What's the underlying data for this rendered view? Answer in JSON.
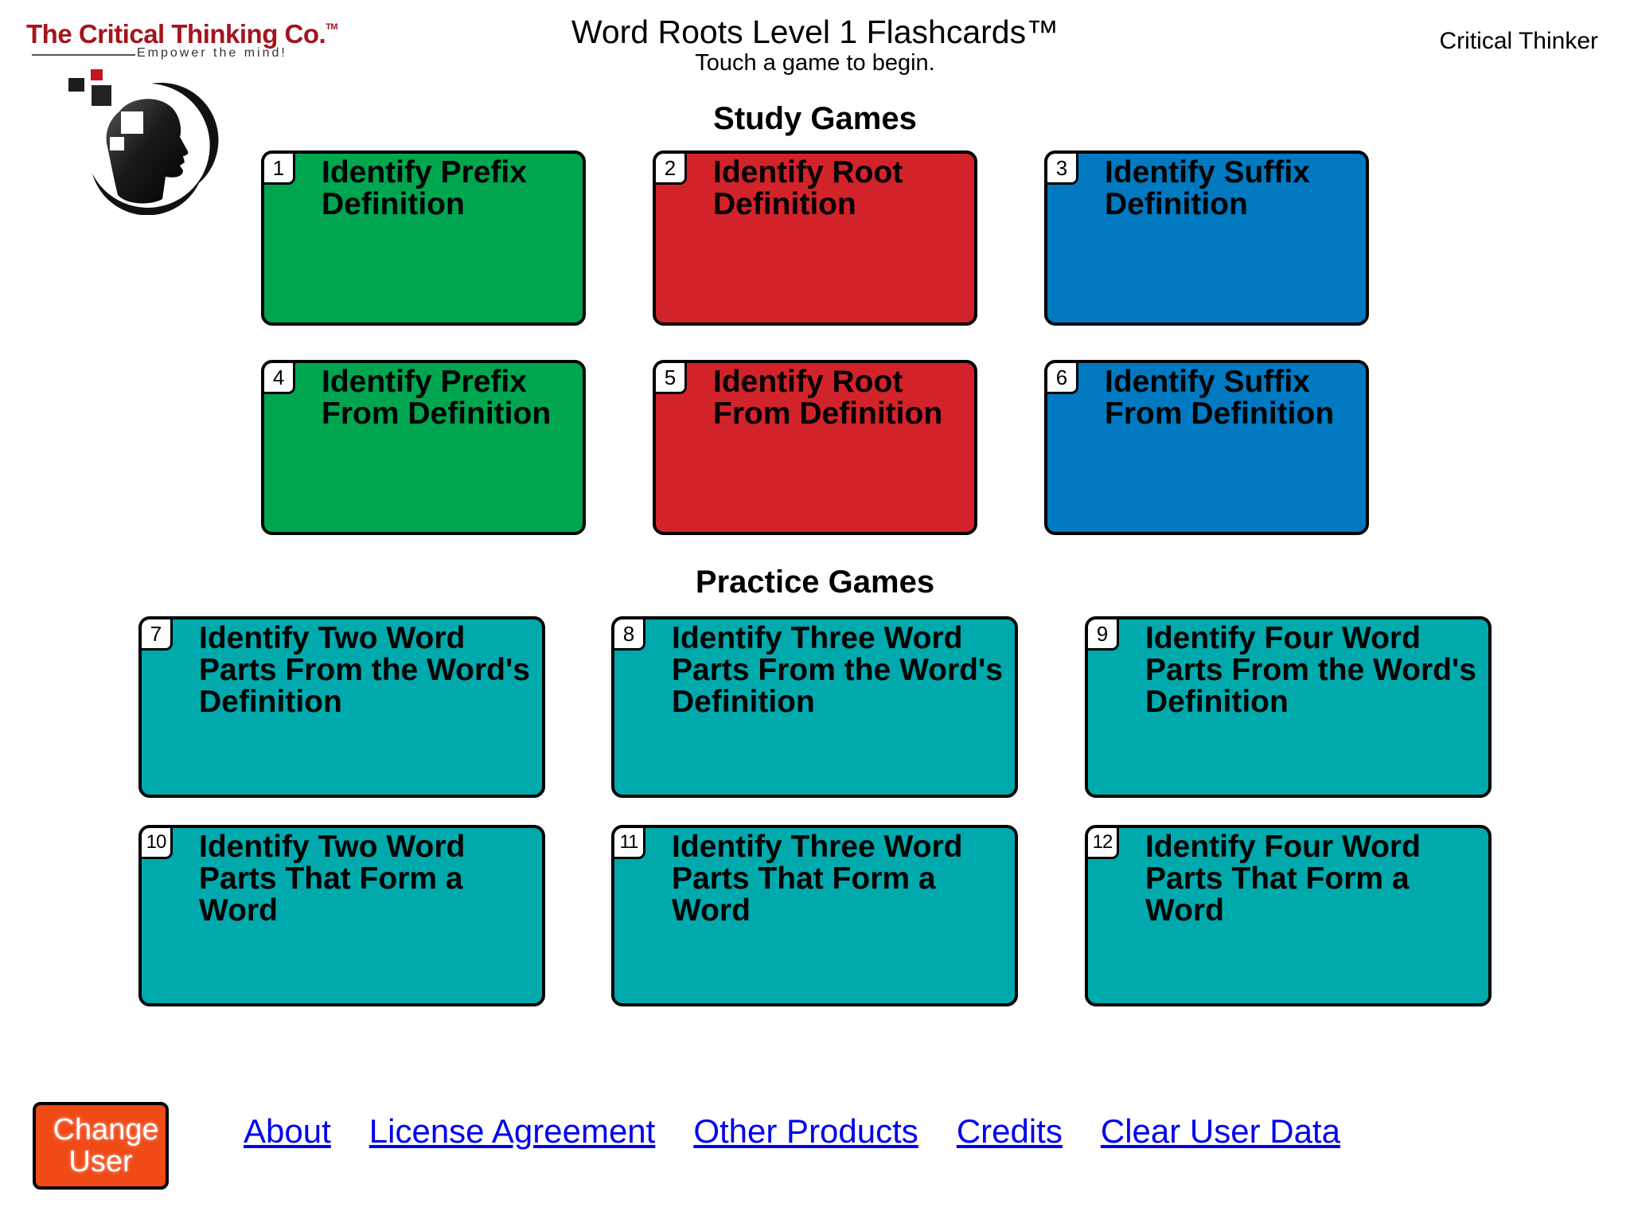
{
  "logo": {
    "company": "The Critical Thinking Co.",
    "trademark": "TM",
    "tagline": "Empower the mind!",
    "icon": "head-silhouette-icon"
  },
  "header": {
    "title": "Word Roots Level 1 Flashcards™",
    "subtitle": "Touch a game to begin.",
    "user_name": "Critical Thinker"
  },
  "colors": {
    "prefix": "#00a550",
    "root": "#d2232a",
    "suffix": "#0079c1",
    "practice": "#00a9ac",
    "change_user": "#f04a17",
    "link": "#0000ee"
  },
  "study": {
    "title": "Study Games",
    "cards": [
      {
        "number": "1",
        "label": "Identify Prefix Definition",
        "color": "#00a550"
      },
      {
        "number": "2",
        "label": "Identify Root Definition",
        "color": "#d2232a"
      },
      {
        "number": "3",
        "label": "Identify Suffix Definition",
        "color": "#0079c1"
      },
      {
        "number": "4",
        "label": "Identify Prefix From Definition",
        "color": "#00a550"
      },
      {
        "number": "5",
        "label": "Identify Root From Definition",
        "color": "#d2232a"
      },
      {
        "number": "6",
        "label": "Identify Suffix From Definition",
        "color": "#0079c1"
      }
    ]
  },
  "practice": {
    "title": "Practice Games",
    "cards": [
      {
        "number": "7",
        "label": "Identify Two Word Parts From the Word's Definition",
        "color": "#00a9ac"
      },
      {
        "number": "8",
        "label": "Identify Three Word Parts From the Word's Definition",
        "color": "#00a9ac"
      },
      {
        "number": "9",
        "label": "Identify Four Word Parts From the Word's Definition",
        "color": "#00a9ac"
      },
      {
        "number": "10",
        "label": "Identify Two Word Parts That Form a Word",
        "color": "#00a9ac"
      },
      {
        "number": "11",
        "label": "Identify Three Word Parts That Form a Word",
        "color": "#00a9ac"
      },
      {
        "number": "12",
        "label": "Identify Four Word Parts That Form a Word",
        "color": "#00a9ac"
      }
    ]
  },
  "footer": {
    "change_user": "Change User",
    "links": [
      "About",
      "License Agreement",
      "Other Products",
      "Credits",
      "Clear User Data"
    ]
  }
}
